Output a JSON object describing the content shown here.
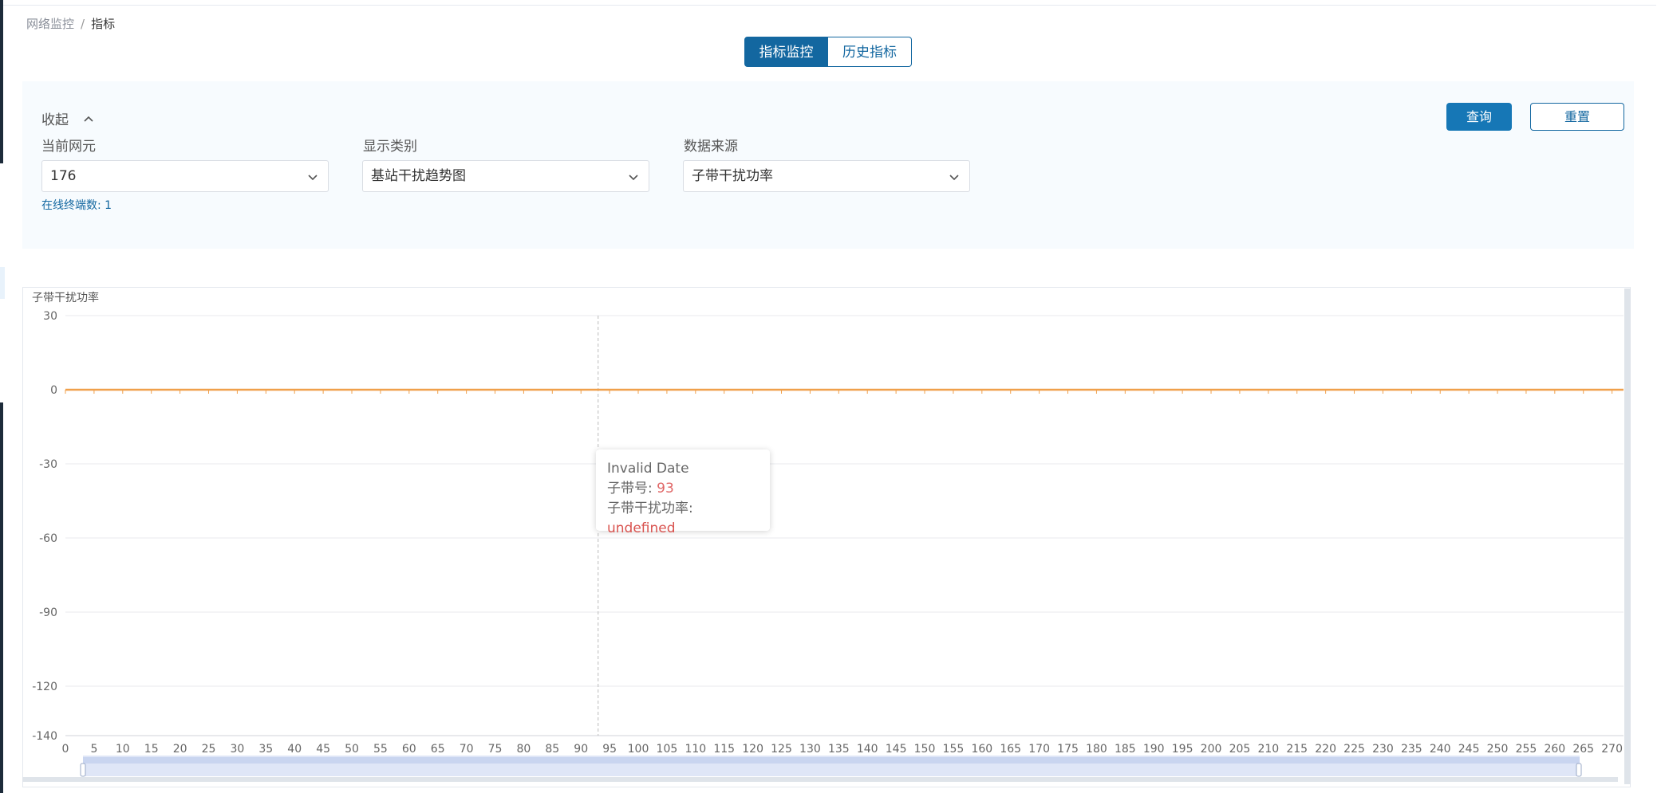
{
  "breadcrumb": {
    "parent": "网络监控",
    "separator": "/",
    "current": "指标"
  },
  "tabs": [
    {
      "label": "指标监控",
      "active": true
    },
    {
      "label": "历史指标",
      "active": false
    }
  ],
  "filter": {
    "collapse_label": "收起",
    "query_label": "查询",
    "reset_label": "重置",
    "fields": [
      {
        "label": "当前网元",
        "value": "176"
      },
      {
        "label": "显示类别",
        "value": "基站干扰趋势图"
      },
      {
        "label": "数据来源",
        "value": "子带干扰功率"
      }
    ],
    "online_text": "在线终端数: 1"
  },
  "chart_data": {
    "type": "line",
    "title": "子带干扰功率",
    "ylabel": "子带干扰功率",
    "ylim": [
      -140,
      30
    ],
    "y_ticks": [
      "30",
      "0",
      "-30",
      "-60",
      "-90",
      "-120",
      "-140"
    ],
    "x_ticks": [
      "0",
      "5",
      "10",
      "15",
      "20",
      "25",
      "30",
      "35",
      "40",
      "45",
      "50",
      "55",
      "60",
      "65",
      "70",
      "75",
      "80",
      "85",
      "90",
      "95",
      "100",
      "105",
      "110",
      "115",
      "120",
      "125",
      "130",
      "135",
      "140",
      "145",
      "150",
      "155",
      "160",
      "165",
      "170",
      "175",
      "180",
      "185",
      "190",
      "195",
      "200",
      "205",
      "210",
      "215",
      "220",
      "225",
      "230",
      "235",
      "240",
      "245",
      "250",
      "255",
      "260",
      "265",
      "270"
    ],
    "xlim": [
      0,
      272
    ],
    "series": [
      {
        "name": "子带干扰功率",
        "color": "#f0a04b",
        "x": [
          0,
          272
        ],
        "values": [
          0,
          0
        ]
      }
    ],
    "crosshair_x": 93,
    "grid": true
  },
  "tooltip": {
    "title": "Invalid Date",
    "row1_label": "子带号: ",
    "row1_value": "93",
    "row2_label": "子带干扰功率: ",
    "row2_value": "undefined"
  },
  "colors": {
    "primary": "#1367a0",
    "line": "#f0a04b"
  }
}
